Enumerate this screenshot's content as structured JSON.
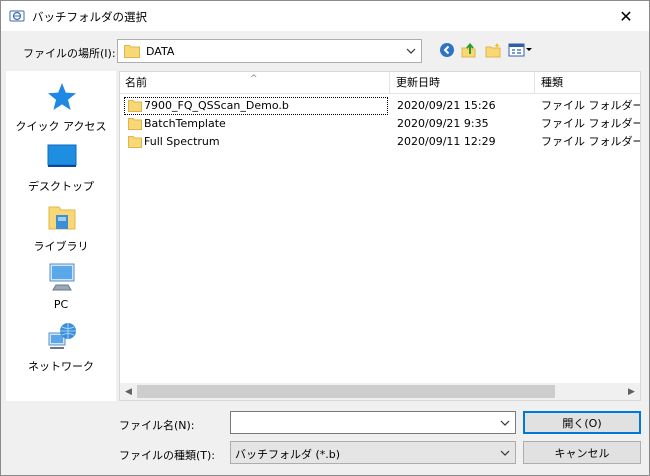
{
  "window": {
    "title": "バッチフォルダの選択",
    "close_glyph": "✕"
  },
  "lookin": {
    "label": "ファイルの場所(I):",
    "value": "DATA"
  },
  "places": [
    {
      "label": "クイック アクセス",
      "icon": "star-icon"
    },
    {
      "label": "デスクトップ",
      "icon": "desktop-icon"
    },
    {
      "label": "ライブラリ",
      "icon": "library-icon"
    },
    {
      "label": "PC",
      "icon": "pc-icon"
    },
    {
      "label": "ネットワーク",
      "icon": "network-icon"
    }
  ],
  "columns": {
    "name": "名前",
    "modified": "更新日時",
    "type": "種類"
  },
  "rows": [
    {
      "name": "7900_FQ_QSScan_Demo.b",
      "modified": "2020/09/21 15:26",
      "type": "ファイル フォルダー"
    },
    {
      "name": "BatchTemplate",
      "modified": "2020/09/21 9:35",
      "type": "ファイル フォルダー"
    },
    {
      "name": "Full Spectrum",
      "modified": "2020/09/11 12:29",
      "type": "ファイル フォルダー"
    }
  ],
  "filename": {
    "label": "ファイル名(N):",
    "value": ""
  },
  "filetype": {
    "label": "ファイルの種類(T):",
    "value": "バッチフォルダ (*.b)"
  },
  "buttons": {
    "open": "開く(O)",
    "cancel": "キャンセル"
  },
  "colors": {
    "accent": "#0078d7",
    "folder": "#f8d775",
    "folder_dark": "#e0b44c"
  }
}
